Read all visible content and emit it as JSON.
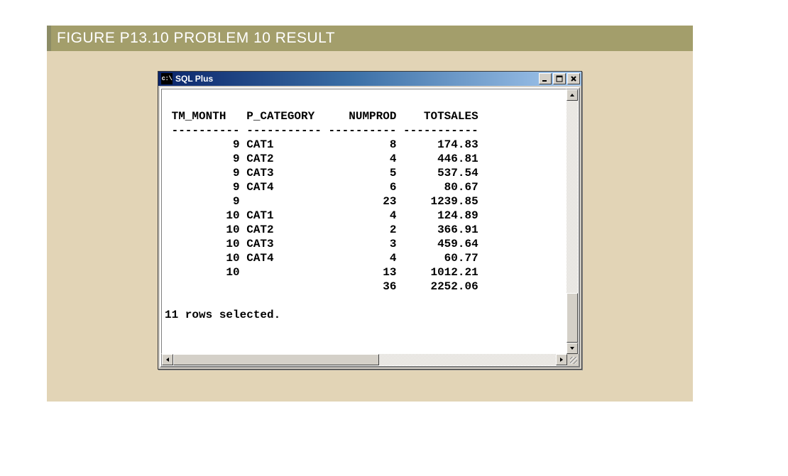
{
  "figure": {
    "label": "FIGURE P13.10  PROBLEM 10 RESULT"
  },
  "window": {
    "app_prefix": "c:\\",
    "title": "SQL Plus",
    "columns": [
      "TM_MONTH",
      "P_CATEGORY",
      "NUMPROD",
      "TOTSALES"
    ],
    "rows": [
      {
        "tm_month": "9",
        "p_category": "CAT1",
        "numprod": "8",
        "totsales": "174.83"
      },
      {
        "tm_month": "9",
        "p_category": "CAT2",
        "numprod": "4",
        "totsales": "446.81"
      },
      {
        "tm_month": "9",
        "p_category": "CAT3",
        "numprod": "5",
        "totsales": "537.54"
      },
      {
        "tm_month": "9",
        "p_category": "CAT4",
        "numprod": "6",
        "totsales": "80.67"
      },
      {
        "tm_month": "9",
        "p_category": "",
        "numprod": "23",
        "totsales": "1239.85"
      },
      {
        "tm_month": "10",
        "p_category": "CAT1",
        "numprod": "4",
        "totsales": "124.89"
      },
      {
        "tm_month": "10",
        "p_category": "CAT2",
        "numprod": "2",
        "totsales": "366.91"
      },
      {
        "tm_month": "10",
        "p_category": "CAT3",
        "numprod": "3",
        "totsales": "459.64"
      },
      {
        "tm_month": "10",
        "p_category": "CAT4",
        "numprod": "4",
        "totsales": "60.77"
      },
      {
        "tm_month": "10",
        "p_category": "",
        "numprod": "13",
        "totsales": "1012.21"
      },
      {
        "tm_month": "",
        "p_category": "",
        "numprod": "36",
        "totsales": "2252.06"
      }
    ],
    "footer": "11 rows selected."
  }
}
